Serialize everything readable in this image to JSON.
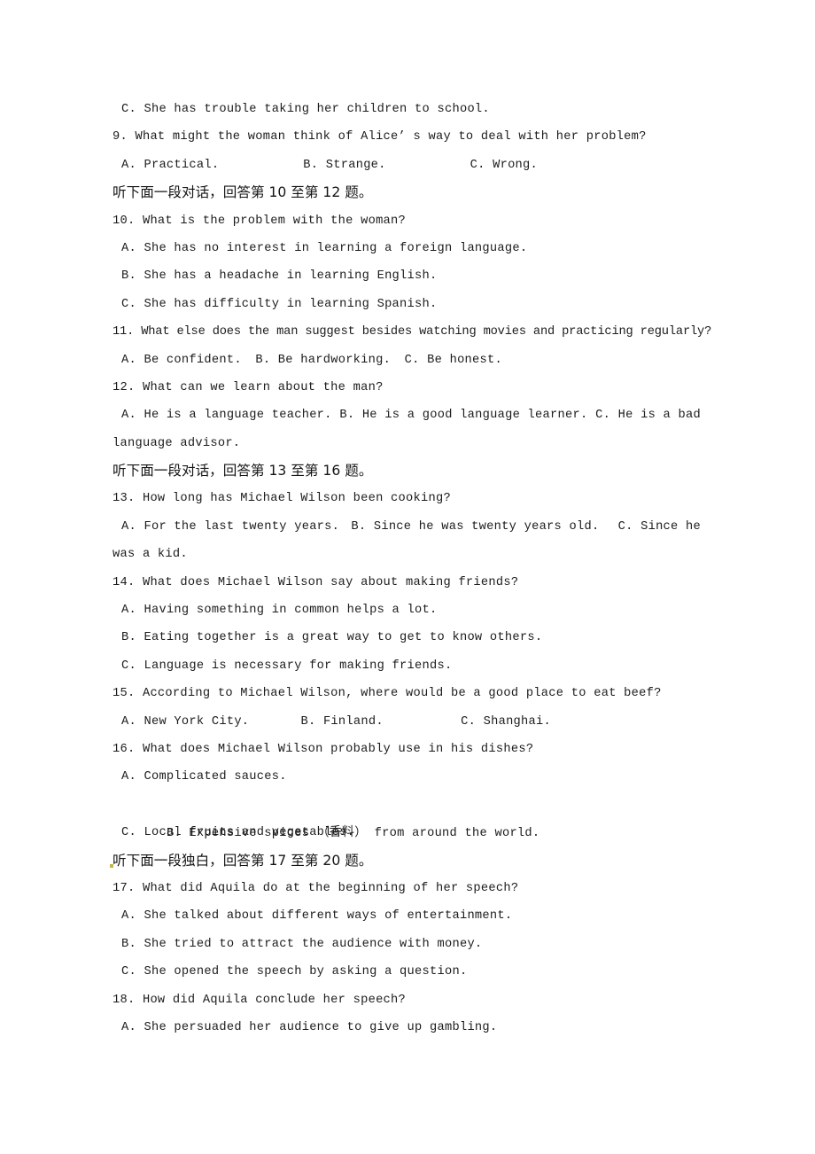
{
  "page": {
    "kind": "exam-paper",
    "language": "English listening comprehension with Chinese directions",
    "background_color": "#ffffff",
    "text_color": "#1c1c1c",
    "artifact_color": "#b8a828"
  },
  "lines": [
    {
      "id": "q8-option-c",
      "role": "option",
      "text": "C. She has trouble taking her children to school."
    },
    {
      "id": "q9-stem",
      "role": "stem",
      "text": "9. What might the woman think of Alice’ s way to deal with her problem?"
    },
    {
      "id": "q9-options",
      "role": "option-row",
      "segments": [
        "A. Practical.",
        "B. Strange.",
        "C. Wrong."
      ]
    },
    {
      "id": "direction-10-12",
      "role": "direction-cn",
      "text": "听下面一段对话，回答第 10 至第 12 题。"
    },
    {
      "id": "q10-stem",
      "role": "stem",
      "text": "10. What is the problem with the woman?"
    },
    {
      "id": "q10-option-a",
      "role": "option",
      "text": "A. She has no interest in learning a foreign language."
    },
    {
      "id": "q10-option-b",
      "role": "option",
      "text": "B. She has a headache in learning English."
    },
    {
      "id": "q10-option-c",
      "role": "option",
      "text": "C. She has difficulty in learning Spanish."
    },
    {
      "id": "q11-stem",
      "role": "stem-tight",
      "text": "11. What else does the man suggest besides watching movies and practicing regularly?"
    },
    {
      "id": "q11-options",
      "role": "option-row",
      "segments": [
        "A. Be confident.",
        "B. Be hardworking.",
        "C. Be honest."
      ]
    },
    {
      "id": "q12-stem",
      "role": "stem",
      "text": "12. What can we learn about the man?"
    },
    {
      "id": "q12-options",
      "role": "option-row",
      "segments": [
        "A. He is a language teacher.",
        "B. He is a good language learner.",
        "C. He is a bad"
      ]
    },
    {
      "id": "q12-options-cont",
      "role": "continuation",
      "text": "language advisor."
    },
    {
      "id": "direction-13-16",
      "role": "direction-cn",
      "text": "听下面一段对话，回答第 13 至第 16 题。"
    },
    {
      "id": "q13-stem",
      "role": "stem",
      "text": "13. How long has Michael Wilson been cooking?"
    },
    {
      "id": "q13-options",
      "role": "option-row",
      "segments": [
        "A. For the last twenty years.",
        "B. Since he was twenty years old.",
        "C. Since he"
      ]
    },
    {
      "id": "q13-options-cont",
      "role": "continuation",
      "text": "was a kid."
    },
    {
      "id": "q14-stem",
      "role": "stem",
      "text": "14. What does Michael Wilson say about making friends?"
    },
    {
      "id": "q14-option-a",
      "role": "option",
      "text": "A. Having something in common helps a lot."
    },
    {
      "id": "q14-option-b",
      "role": "option",
      "text": "B. Eating together is a great way to get to know others."
    },
    {
      "id": "q14-option-c",
      "role": "option",
      "text": "C. Language is necessary for making friends."
    },
    {
      "id": "q15-stem",
      "role": "stem",
      "text": "15. According to Michael Wilson, where would be a good place to eat beef?"
    },
    {
      "id": "q15-options",
      "role": "option-row",
      "segments": [
        "A. New York City.",
        "B. Finland.",
        "C. Shanghai."
      ]
    },
    {
      "id": "q16-stem",
      "role": "stem",
      "text": "16. What does Michael Wilson probably use in his dishes?"
    },
    {
      "id": "q16-option-a",
      "role": "option",
      "text": "A. Complicated sauces."
    },
    {
      "id": "q16-option-b",
      "role": "option-gloss",
      "text_before": "B. Expensive spices （",
      "gloss": "香料",
      "text_after": "） from around the world."
    },
    {
      "id": "q16-option-c",
      "role": "option",
      "text": "C. Local fruits and vegetables."
    },
    {
      "id": "direction-17-20",
      "role": "direction-cn",
      "text": "听下面一段独白，回答第 17 至第 20 题。"
    },
    {
      "id": "q17-stem",
      "role": "stem",
      "text": "17. What did Aquila do at the beginning of her speech?"
    },
    {
      "id": "q17-option-a",
      "role": "option",
      "text": "A. She talked about different ways of entertainment."
    },
    {
      "id": "q17-option-b",
      "role": "option",
      "text": "B. She tried to attract the audience with money."
    },
    {
      "id": "q17-option-c",
      "role": "option",
      "text": "C. She opened the speech by asking a question."
    },
    {
      "id": "q18-stem",
      "role": "stem",
      "text": "18. How did Aquila conclude her speech?"
    },
    {
      "id": "q18-option-a",
      "role": "option",
      "text": "A. She persuaded her audience to give up gambling."
    }
  ]
}
